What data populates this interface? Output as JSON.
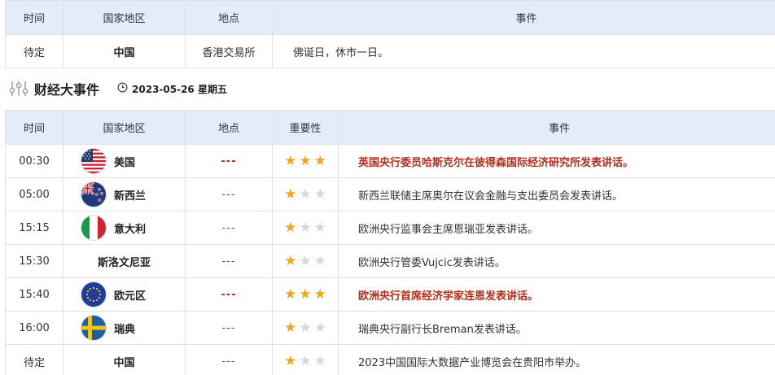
{
  "holiday_table": {
    "headers": {
      "time": "时间",
      "region": "国家地区",
      "location": "地点",
      "event": "事件"
    },
    "row": {
      "time": "待定",
      "region": "中国",
      "location": "香港交易所",
      "event": "佛诞日，休市一日。"
    }
  },
  "section": {
    "title": "财经大事件",
    "date": "2023-05-26 星期五"
  },
  "events_table": {
    "headers": {
      "time": "时间",
      "region": "国家地区",
      "location": "地点",
      "importance": "重要性",
      "event": "事件"
    },
    "rows": [
      {
        "time": "00:30",
        "region": "美国",
        "flag": "us-flag-icon",
        "location": "---",
        "stars": 3,
        "event": "英国央行委员哈斯克尔在彼得森国际经济研究所发表讲话。",
        "important": true
      },
      {
        "time": "05:00",
        "region": "新西兰",
        "flag": "nz-flag-icon",
        "location": "---",
        "stars": 1,
        "event": "新西兰联储主席奥尔在议会金融与支出委员会发表讲话。",
        "important": false
      },
      {
        "time": "15:15",
        "region": "意大利",
        "flag": "it-flag-icon",
        "location": "---",
        "stars": 1,
        "event": "欧洲央行监事会主席恩瑞亚发表讲话。",
        "important": false
      },
      {
        "time": "15:30",
        "region": "斯洛文尼亚",
        "flag": "",
        "location": "---",
        "stars": 1,
        "event": "欧洲央行管委Vujcic发表讲话。",
        "important": false
      },
      {
        "time": "15:40",
        "region": "欧元区",
        "flag": "eu-flag-icon",
        "location": "---",
        "stars": 3,
        "event": "欧洲央行首席经济学家连恩发表讲话。",
        "important": true
      },
      {
        "time": "16:00",
        "region": "瑞典",
        "flag": "se-flag-icon",
        "location": "---",
        "stars": 1,
        "event": "瑞典央行副行长Breman发表讲话。",
        "important": false
      },
      {
        "time": "待定",
        "region": "中国",
        "flag": "",
        "location": "---",
        "stars": 1,
        "event": "2023中国国际大数据产业博览会在贵阳市举办。",
        "important": false
      }
    ]
  },
  "colors": {
    "header_bg": "#e3edf9",
    "important_text": "#b32d1c",
    "star_on": "#f1a51c",
    "star_off": "#d7d7d7",
    "border": "#dfe3e8"
  }
}
